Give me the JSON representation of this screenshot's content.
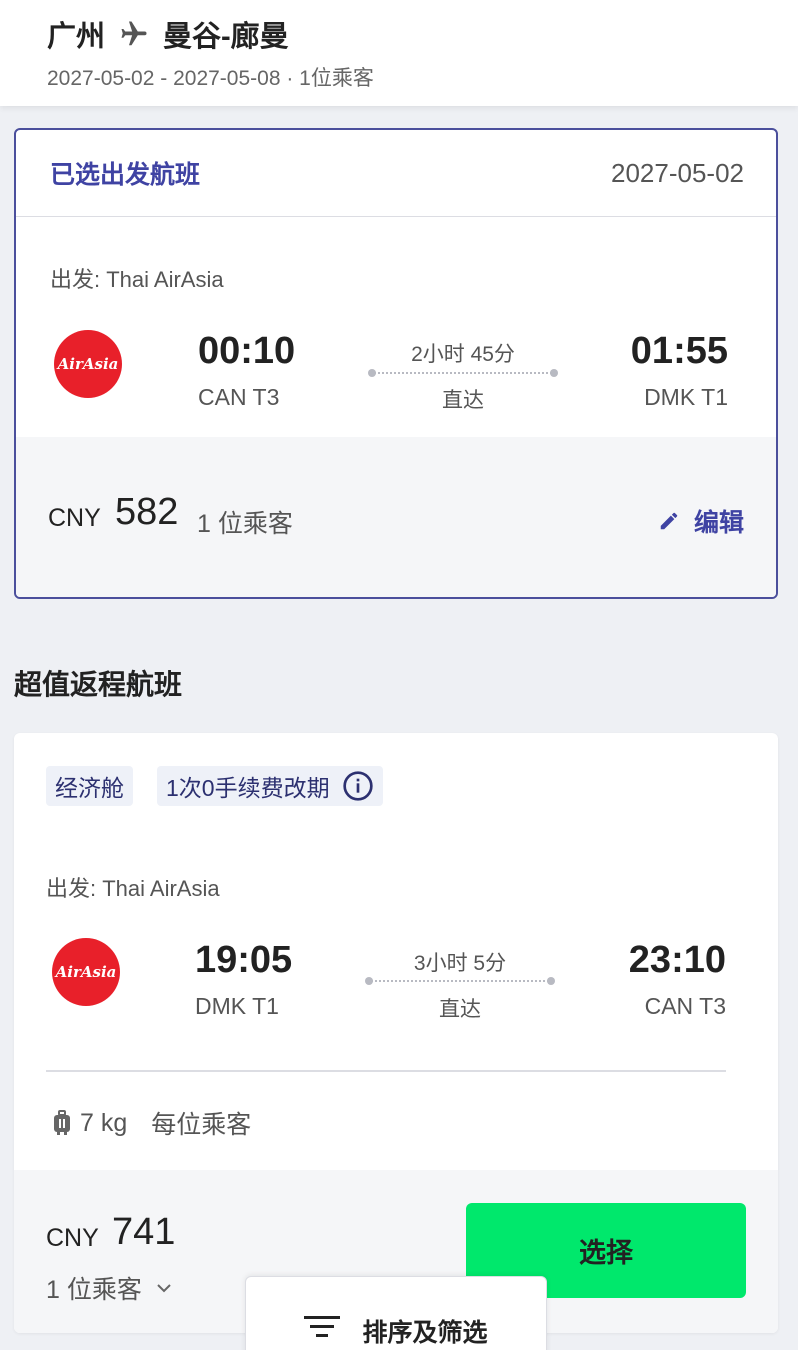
{
  "header": {
    "origin": "广州",
    "destination": "曼谷-廊曼",
    "plane_icon": "airplane-icon",
    "subtitle": "2027-05-02 - 2027-05-08 · 1位乘客"
  },
  "selected_flight": {
    "title": "已选出发航班",
    "date": "2027-05-02",
    "carrier": "出发: Thai AirAsia",
    "logo_text": "AirAsia",
    "depart_time": "00:10",
    "depart_terminal": "CAN T3",
    "duration": "2小时 45分",
    "stops": "直达",
    "arrive_time": "01:55",
    "arrive_terminal": "DMK T1",
    "currency": "CNY",
    "price": "582",
    "passengers": "1 位乘客",
    "edit_label": "编辑"
  },
  "section_title": "超值返程航班",
  "return_flight": {
    "tag_cabin": "经济舱",
    "tag_change": "1次0手续费改期",
    "carrier": "出发: Thai AirAsia",
    "logo_text": "AirAsia",
    "depart_time": "19:05",
    "depart_terminal": "DMK T1",
    "duration": "3小时 5分",
    "stops": "直达",
    "arrive_time": "23:10",
    "arrive_terminal": "CAN T3",
    "baggage": "7 kg",
    "baggage_note": "每位乘客",
    "currency": "CNY",
    "price": "741",
    "passengers": "1 位乘客",
    "select_label": "选择"
  },
  "sort_filter_label": "排序及筛选",
  "colors": {
    "accent": "#3f43a3",
    "select_button": "#00e86c",
    "airline_red": "#e8202a"
  }
}
